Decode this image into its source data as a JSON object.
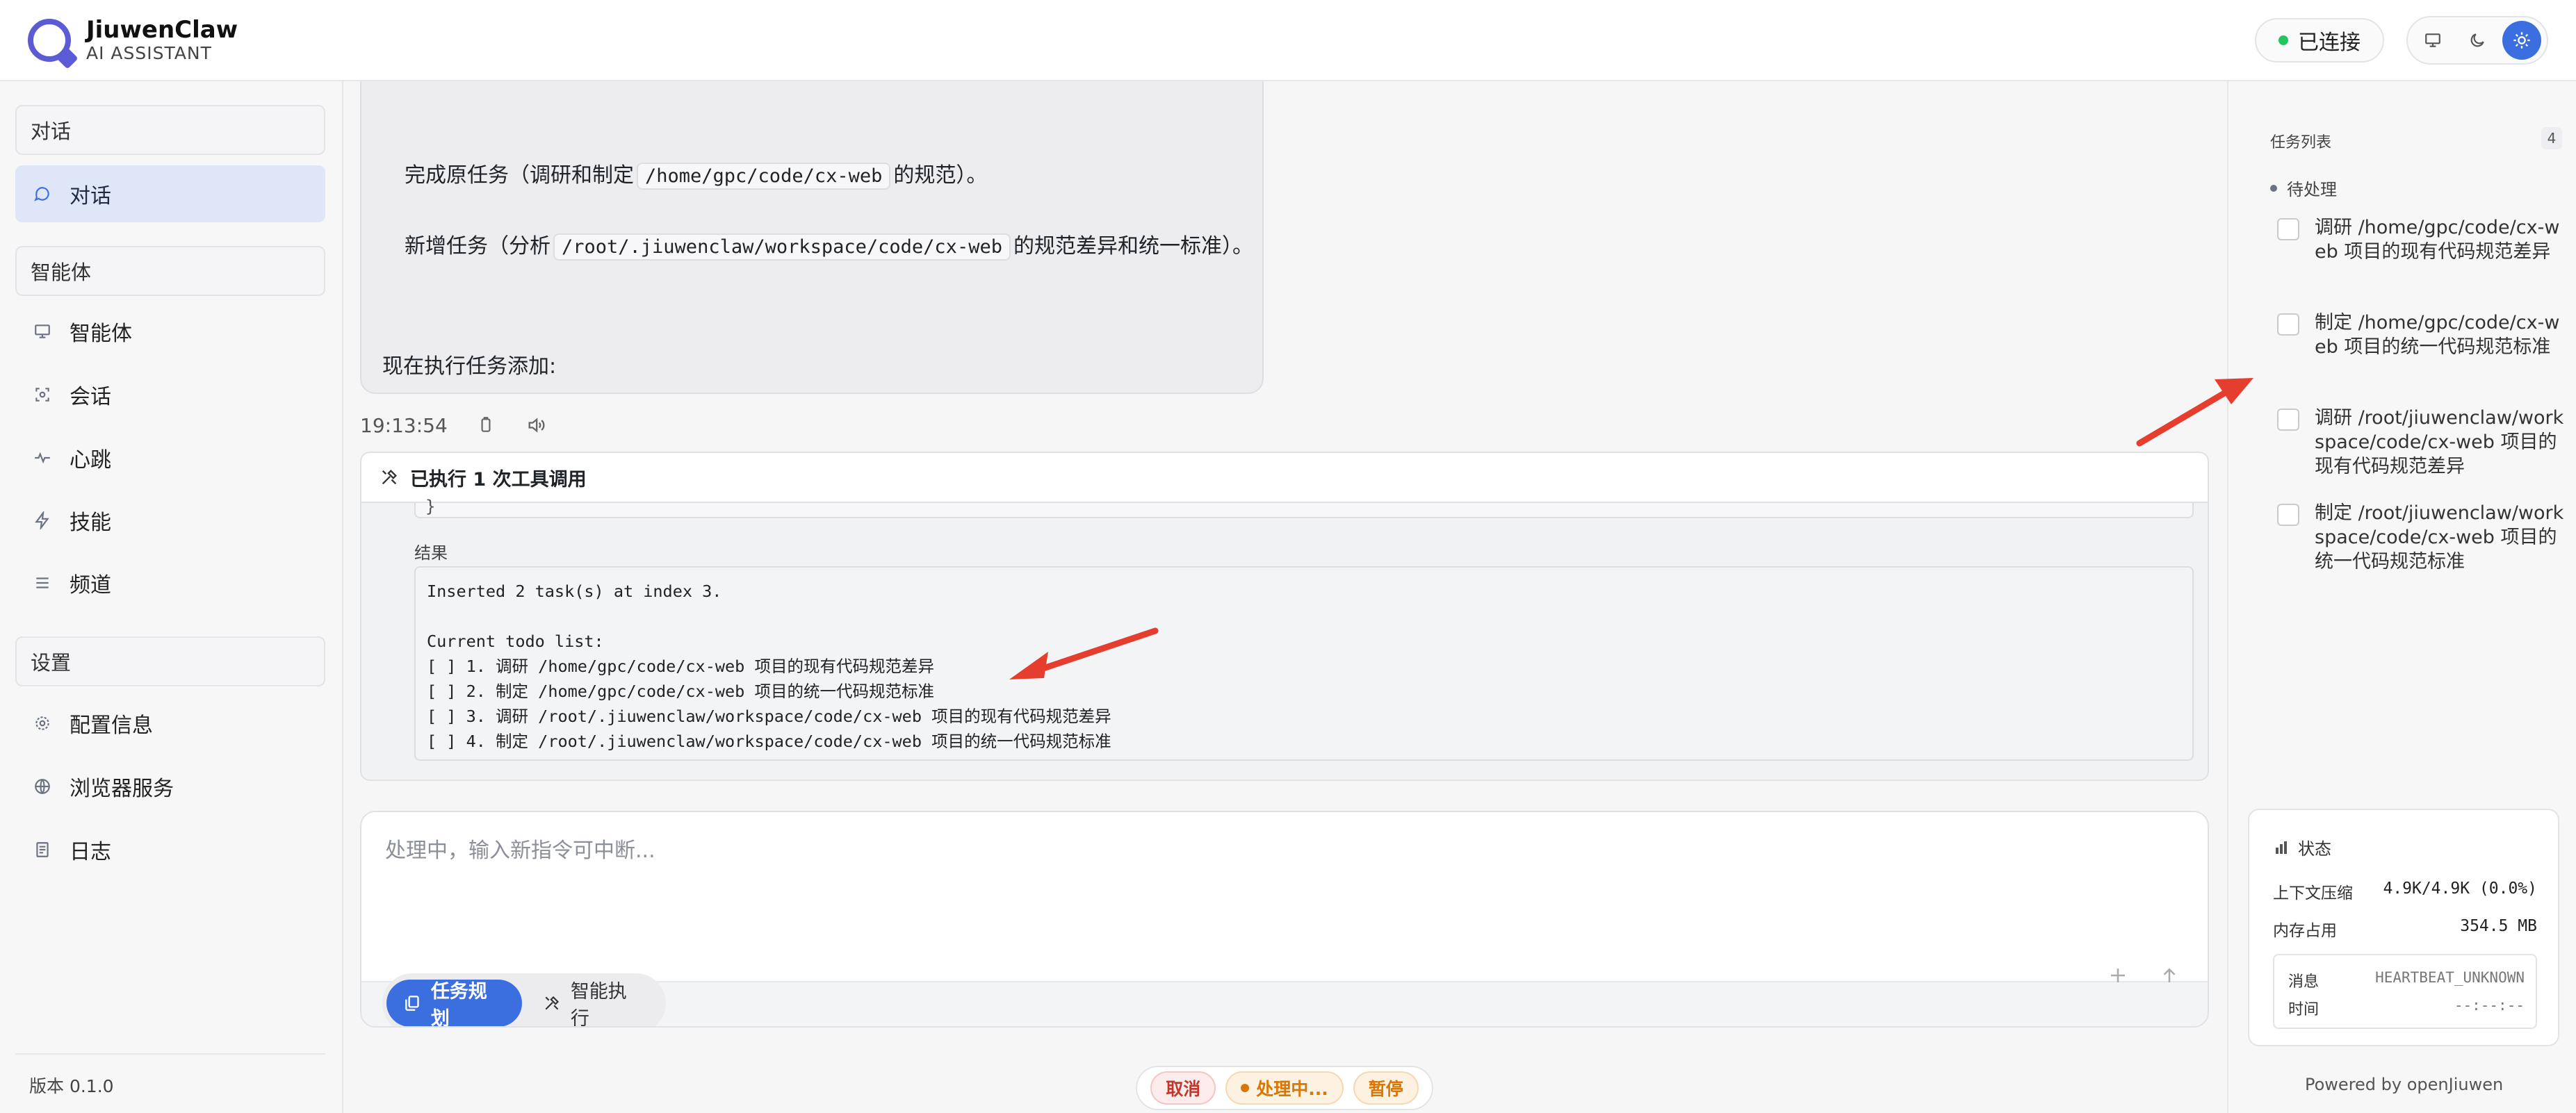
{
  "header": {
    "brand_name": "JiuwenClaw",
    "brand_sub": "AI ASSISTANT",
    "connection_status": "已连接"
  },
  "sidebar": {
    "sections": [
      {
        "title": "对话",
        "items": [
          {
            "label": "对话",
            "icon": "chat-icon",
            "active": true
          }
        ]
      },
      {
        "title": "智能体",
        "items": [
          {
            "label": "智能体",
            "icon": "monitor-icon"
          },
          {
            "label": "会话",
            "icon": "session-icon"
          },
          {
            "label": "心跳",
            "icon": "heartbeat-icon"
          },
          {
            "label": "技能",
            "icon": "lightning-icon"
          },
          {
            "label": "频道",
            "icon": "list-icon"
          }
        ]
      },
      {
        "title": "设置",
        "items": [
          {
            "label": "配置信息",
            "icon": "gear-icon"
          },
          {
            "label": "浏览器服务",
            "icon": "globe-icon"
          },
          {
            "label": "日志",
            "icon": "document-icon"
          }
        ]
      }
    ],
    "version": "版本 0.1.0"
  },
  "chat": {
    "line1_prefix": "完成原任务（调研和制定",
    "line1_code": "/home/gpc/code/cx-web",
    "line1_suffix": "的规范）。",
    "line2_prefix": "新增任务（分析",
    "line2_code": "/root/.jiuwenclaw/workspace/code/cx-web",
    "line2_suffix": "的规范差异和统一标准）。",
    "line3": "现在执行任务添加:",
    "timestamp": "19:13:54"
  },
  "tool_call": {
    "header": "已执行 1 次工具调用",
    "prev_snippet": "}",
    "result_label": "结果",
    "result_text": "Inserted 2 task(s) at index 3.\n\nCurrent todo list:\n[ ] 1. 调研 /home/gpc/code/cx-web 项目的现有代码规范差异\n[ ] 2. 制定 /home/gpc/code/cx-web 项目的统一代码规范标准\n[ ] 3. 调研 /root/.jiuwenclaw/workspace/code/cx-web 项目的现有代码规范差异\n[ ] 4. 制定 /root/.jiuwenclaw/workspace/code/cx-web 项目的统一代码规范标准"
  },
  "input": {
    "placeholder": "处理中，输入新指令可中断...",
    "mode_plan": "任务规划",
    "mode_exec": "智能执行"
  },
  "controls": {
    "cancel": "取消",
    "processing": "处理中...",
    "pause": "暂停"
  },
  "tasks": {
    "title": "任务列表",
    "count": "4",
    "pending_label": "待处理",
    "items": [
      "调研 /home/gpc/code/cx-web 项目的现有代码规范差异",
      "制定 /home/gpc/code/cx-web 项目的统一代码规范标准",
      "调研 /root/jiuwenclaw/workspace/code/cx-web 项目的现有代码规范差异",
      "制定 /root/jiuwenclaw/workspace/code/cx-web 项目的统一代码规范标准"
    ]
  },
  "status": {
    "title": "状态",
    "context_label": "上下文压缩",
    "context_value": "4.9K/4.9K (0.0%)",
    "memory_label": "内存占用",
    "memory_value": "354.5 MB",
    "message_label": "消息",
    "message_value": "HEARTBEAT_UNKNOWN",
    "time_label": "时间",
    "time_value": "--:--:--"
  },
  "footer": {
    "powered": "Powered by openJiuwen"
  },
  "colors": {
    "accent": "#3b6fe0",
    "connected": "#22c55e",
    "annotation_arrow": "#e53e2e"
  }
}
